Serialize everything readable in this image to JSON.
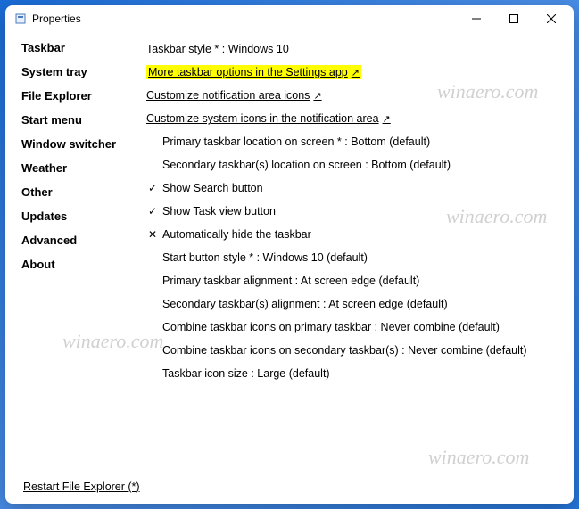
{
  "window": {
    "title": "Properties"
  },
  "sidebar": {
    "items": [
      {
        "label": "Taskbar",
        "active": true
      },
      {
        "label": "System tray"
      },
      {
        "label": "File Explorer"
      },
      {
        "label": "Start menu"
      },
      {
        "label": "Window switcher"
      },
      {
        "label": "Weather"
      },
      {
        "label": "Other"
      },
      {
        "label": "Updates"
      },
      {
        "label": "Advanced"
      },
      {
        "label": "About"
      }
    ]
  },
  "main": {
    "style_label": "Taskbar style * : Windows 10",
    "more_link": "More taskbar options in the Settings app",
    "custom_notif_link": "Customize notification area icons",
    "custom_sys_link": "Customize system icons in the notification area",
    "primary_loc": "Primary taskbar location on screen * : Bottom (default)",
    "secondary_loc": "Secondary taskbar(s) location on screen : Bottom (default)",
    "show_search": "Show Search button",
    "show_taskview": "Show Task view button",
    "auto_hide": "Automatically hide the taskbar",
    "start_style": "Start button style * : Windows 10 (default)",
    "primary_align": "Primary taskbar alignment : At screen edge (default)",
    "secondary_align": "Secondary taskbar(s) alignment : At screen edge (default)",
    "combine_primary": "Combine taskbar icons on primary taskbar : Never combine (default)",
    "combine_secondary": "Combine taskbar icons on secondary taskbar(s) : Never combine (default)",
    "icon_size": "Taskbar icon size : Large (default)"
  },
  "footer": {
    "restart": "Restart File Explorer (*)"
  },
  "watermark": "winaero.com"
}
